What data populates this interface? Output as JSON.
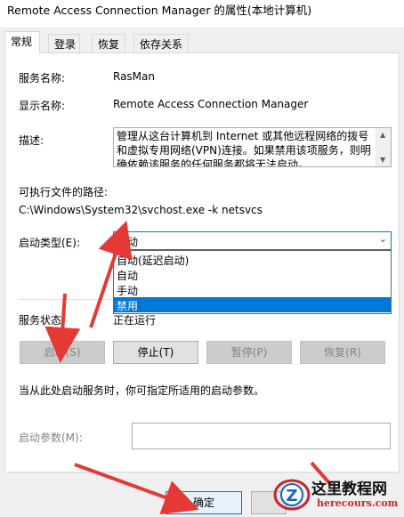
{
  "window": {
    "title": "Remote Access Connection Manager 的属性(本地计算机)"
  },
  "tabs": [
    {
      "label": "常规",
      "active": true
    },
    {
      "label": "登录",
      "active": false
    },
    {
      "label": "恢复",
      "active": false
    },
    {
      "label": "依存关系",
      "active": false
    }
  ],
  "general": {
    "service_name_label": "服务名称:",
    "service_name_value": "RasMan",
    "display_name_label": "显示名称:",
    "display_name_value": "Remote Access Connection Manager",
    "description_label": "描述:",
    "description_value": "管理从这台计算机到 Internet 或其他远程网络的拨号和虚拟专用网络(VPN)连接。如果禁用该项服务，则明确依赖该服务的任何服务都将无法启动。",
    "exe_path_label": "可执行文件的路径:",
    "exe_path_value": "C:\\Windows\\System32\\svchost.exe -k netsvcs",
    "startup_type_label": "启动类型(E):",
    "startup_type_selected": "自动",
    "startup_type_options": [
      "自动(延迟启动)",
      "自动",
      "手动",
      "禁用"
    ],
    "startup_type_highlighted_index": 3,
    "service_status_label": "服务状态:",
    "service_status_value": "正在运行",
    "buttons": {
      "start": "启动(S)",
      "stop": "停止(T)",
      "pause": "暂停(P)",
      "resume": "恢复(R)"
    },
    "hint": "当从此处启动服务时，你可指定所适用的启动参数。",
    "start_params_label": "启动参数(M):",
    "start_params_value": ""
  },
  "footer": {
    "ok_label": "确定"
  },
  "watermark": {
    "logo_letter": "Z",
    "site_name": "这里教程网",
    "site_url": "herecours.com"
  },
  "colors": {
    "accent": "#0078d7",
    "arrow": "#e53935",
    "watermark_red": "#c62828"
  }
}
